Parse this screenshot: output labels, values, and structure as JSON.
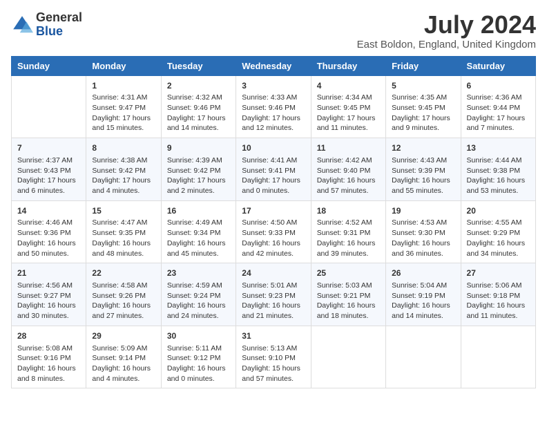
{
  "header": {
    "logo_general": "General",
    "logo_blue": "Blue",
    "title": "July 2024",
    "location": "East Boldon, England, United Kingdom"
  },
  "days_of_week": [
    "Sunday",
    "Monday",
    "Tuesday",
    "Wednesday",
    "Thursday",
    "Friday",
    "Saturday"
  ],
  "weeks": [
    [
      {
        "day": null
      },
      {
        "day": "1",
        "sunrise": "4:31 AM",
        "sunset": "9:47 PM",
        "daylight": "17 hours and 15 minutes."
      },
      {
        "day": "2",
        "sunrise": "4:32 AM",
        "sunset": "9:46 PM",
        "daylight": "17 hours and 14 minutes."
      },
      {
        "day": "3",
        "sunrise": "4:33 AM",
        "sunset": "9:46 PM",
        "daylight": "17 hours and 12 minutes."
      },
      {
        "day": "4",
        "sunrise": "4:34 AM",
        "sunset": "9:45 PM",
        "daylight": "17 hours and 11 minutes."
      },
      {
        "day": "5",
        "sunrise": "4:35 AM",
        "sunset": "9:45 PM",
        "daylight": "17 hours and 9 minutes."
      },
      {
        "day": "6",
        "sunrise": "4:36 AM",
        "sunset": "9:44 PM",
        "daylight": "17 hours and 7 minutes."
      }
    ],
    [
      {
        "day": "7",
        "sunrise": "4:37 AM",
        "sunset": "9:43 PM",
        "daylight": "17 hours and 6 minutes."
      },
      {
        "day": "8",
        "sunrise": "4:38 AM",
        "sunset": "9:42 PM",
        "daylight": "17 hours and 4 minutes."
      },
      {
        "day": "9",
        "sunrise": "4:39 AM",
        "sunset": "9:42 PM",
        "daylight": "17 hours and 2 minutes."
      },
      {
        "day": "10",
        "sunrise": "4:41 AM",
        "sunset": "9:41 PM",
        "daylight": "17 hours and 0 minutes."
      },
      {
        "day": "11",
        "sunrise": "4:42 AM",
        "sunset": "9:40 PM",
        "daylight": "16 hours and 57 minutes."
      },
      {
        "day": "12",
        "sunrise": "4:43 AM",
        "sunset": "9:39 PM",
        "daylight": "16 hours and 55 minutes."
      },
      {
        "day": "13",
        "sunrise": "4:44 AM",
        "sunset": "9:38 PM",
        "daylight": "16 hours and 53 minutes."
      }
    ],
    [
      {
        "day": "14",
        "sunrise": "4:46 AM",
        "sunset": "9:36 PM",
        "daylight": "16 hours and 50 minutes."
      },
      {
        "day": "15",
        "sunrise": "4:47 AM",
        "sunset": "9:35 PM",
        "daylight": "16 hours and 48 minutes."
      },
      {
        "day": "16",
        "sunrise": "4:49 AM",
        "sunset": "9:34 PM",
        "daylight": "16 hours and 45 minutes."
      },
      {
        "day": "17",
        "sunrise": "4:50 AM",
        "sunset": "9:33 PM",
        "daylight": "16 hours and 42 minutes."
      },
      {
        "day": "18",
        "sunrise": "4:52 AM",
        "sunset": "9:31 PM",
        "daylight": "16 hours and 39 minutes."
      },
      {
        "day": "19",
        "sunrise": "4:53 AM",
        "sunset": "9:30 PM",
        "daylight": "16 hours and 36 minutes."
      },
      {
        "day": "20",
        "sunrise": "4:55 AM",
        "sunset": "9:29 PM",
        "daylight": "16 hours and 34 minutes."
      }
    ],
    [
      {
        "day": "21",
        "sunrise": "4:56 AM",
        "sunset": "9:27 PM",
        "daylight": "16 hours and 30 minutes."
      },
      {
        "day": "22",
        "sunrise": "4:58 AM",
        "sunset": "9:26 PM",
        "daylight": "16 hours and 27 minutes."
      },
      {
        "day": "23",
        "sunrise": "4:59 AM",
        "sunset": "9:24 PM",
        "daylight": "16 hours and 24 minutes."
      },
      {
        "day": "24",
        "sunrise": "5:01 AM",
        "sunset": "9:23 PM",
        "daylight": "16 hours and 21 minutes."
      },
      {
        "day": "25",
        "sunrise": "5:03 AM",
        "sunset": "9:21 PM",
        "daylight": "16 hours and 18 minutes."
      },
      {
        "day": "26",
        "sunrise": "5:04 AM",
        "sunset": "9:19 PM",
        "daylight": "16 hours and 14 minutes."
      },
      {
        "day": "27",
        "sunrise": "5:06 AM",
        "sunset": "9:18 PM",
        "daylight": "16 hours and 11 minutes."
      }
    ],
    [
      {
        "day": "28",
        "sunrise": "5:08 AM",
        "sunset": "9:16 PM",
        "daylight": "16 hours and 8 minutes."
      },
      {
        "day": "29",
        "sunrise": "5:09 AM",
        "sunset": "9:14 PM",
        "daylight": "16 hours and 4 minutes."
      },
      {
        "day": "30",
        "sunrise": "5:11 AM",
        "sunset": "9:12 PM",
        "daylight": "16 hours and 0 minutes."
      },
      {
        "day": "31",
        "sunrise": "5:13 AM",
        "sunset": "9:10 PM",
        "daylight": "15 hours and 57 minutes."
      },
      {
        "day": null
      },
      {
        "day": null
      },
      {
        "day": null
      }
    ]
  ],
  "labels": {
    "sunrise": "Sunrise:",
    "sunset": "Sunset:",
    "daylight": "Daylight:"
  }
}
